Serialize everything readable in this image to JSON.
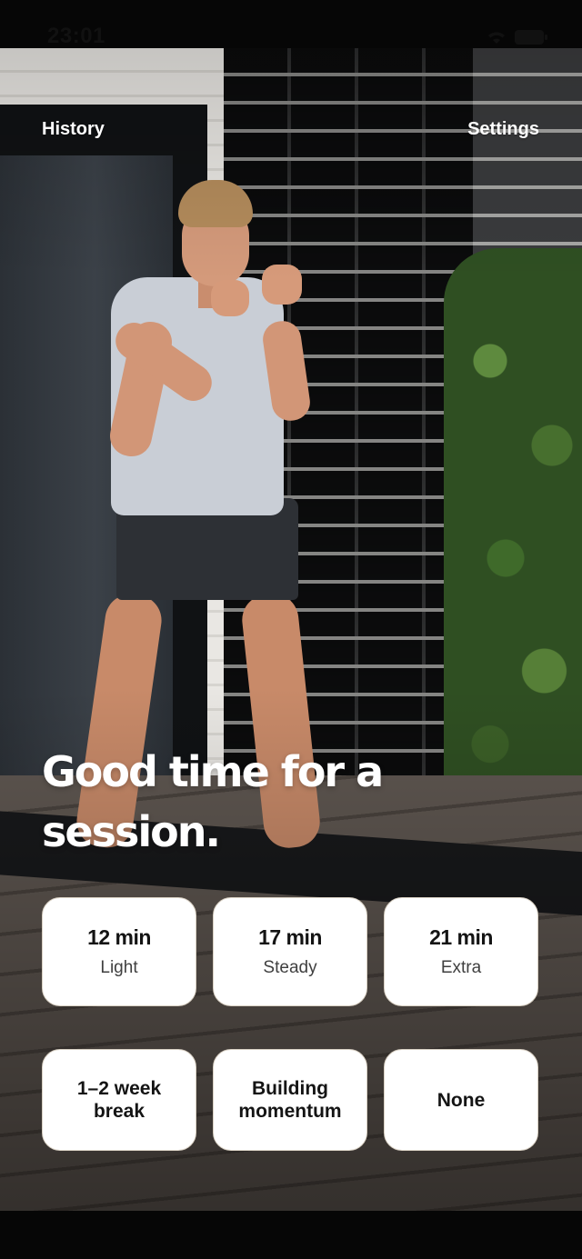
{
  "status_bar": {
    "time": "23:01"
  },
  "header": {
    "history_label": "History",
    "settings_label": "Settings"
  },
  "headline": {
    "line1": "Good time for a",
    "line2_highlight": "ses",
    "line2_rest": "sion."
  },
  "duration_options": [
    {
      "title": "12 min",
      "subtitle": "Light"
    },
    {
      "title": "17 min",
      "subtitle": "Steady"
    },
    {
      "title": "21 min",
      "subtitle": "Extra"
    }
  ],
  "state_options": [
    {
      "label": "1–2 week break"
    },
    {
      "label": "Building momentum"
    },
    {
      "label": "None"
    }
  ],
  "colors": {
    "accent_underline": "#9fd9b4",
    "card_bg": "#ffffff",
    "card_border": "#d9d1c4"
  },
  "icons": [
    "wifi-icon",
    "battery-icon"
  ]
}
